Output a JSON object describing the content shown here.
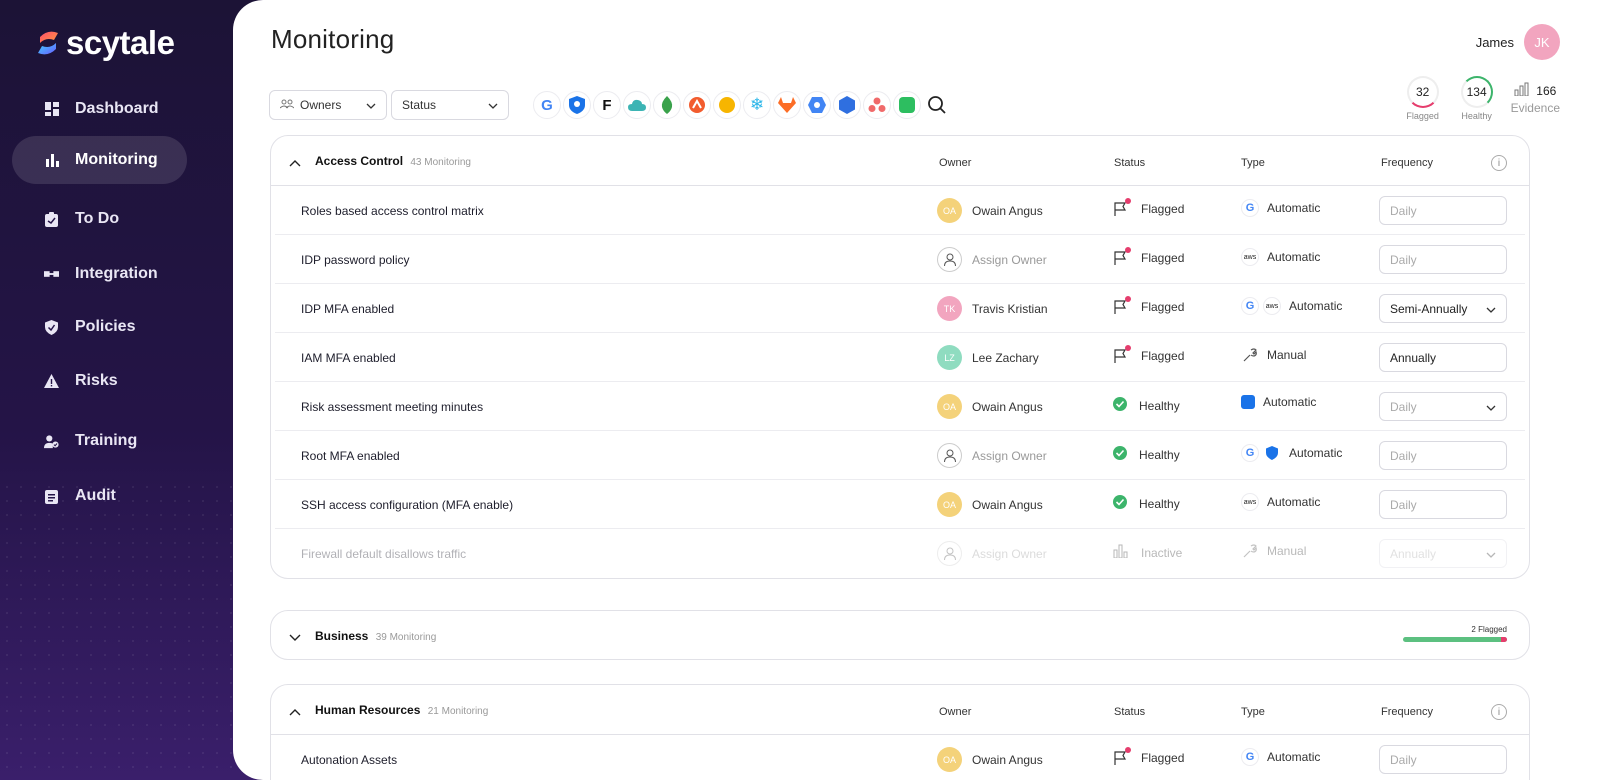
{
  "brand": {
    "name": "scytale"
  },
  "nav": [
    {
      "label": "Dashboard",
      "icon": "dashboard-icon"
    },
    {
      "label": "Monitoring",
      "icon": "bar-chart-icon",
      "active": true
    },
    {
      "label": "To Do",
      "icon": "clipboard-icon"
    },
    {
      "label": "Integration",
      "icon": "integration-icon"
    },
    {
      "label": "Policies",
      "icon": "shield-icon"
    },
    {
      "label": "Risks",
      "icon": "warning-icon"
    },
    {
      "label": "Training",
      "icon": "user-check-icon"
    },
    {
      "label": "Audit",
      "icon": "audit-icon"
    }
  ],
  "header": {
    "title": "Monitoring",
    "user_name": "James",
    "user_initials": "JK"
  },
  "filters": {
    "owners": "Owners",
    "status": "Status"
  },
  "integrations": [
    "google",
    "shield",
    "figma",
    "cloud",
    "mongodb",
    "atlassian",
    "miro",
    "snowflake",
    "gitlab",
    "gcp",
    "cube",
    "asana",
    "evernote"
  ],
  "stats": {
    "flagged_value": "32",
    "flagged_label": "Flagged",
    "healthy_value": "134",
    "healthy_label": "Healthy",
    "evidence_value": "166",
    "evidence_label": "Evidence"
  },
  "columns": {
    "owner": "Owner",
    "status": "Status",
    "type": "Type",
    "frequency": "Frequency"
  },
  "sections": [
    {
      "name": "Access Control",
      "count": "43 Monitoring",
      "rows": [
        {
          "name": "Roles based access control matrix",
          "owner": "Owain Angus",
          "initials": "OA",
          "avatar_color": "#f4d27a",
          "status": "Flagged",
          "type": "Automatic",
          "type_icons": [
            "G"
          ],
          "frequency": "Daily",
          "freq_placeholder": true,
          "dropdown": false
        },
        {
          "name": "IDP password policy",
          "owner": "Assign Owner",
          "initials": "",
          "avatar_color": "",
          "status": "Flagged",
          "type": "Automatic",
          "type_icons": [
            "aws"
          ],
          "frequency": "Daily",
          "freq_placeholder": true,
          "dropdown": false
        },
        {
          "name": "IDP MFA enabled",
          "owner": "Travis Kristian",
          "initials": "TK",
          "avatar_color": "#f2a5bf",
          "status": "Flagged",
          "type": "Automatic",
          "type_icons": [
            "G",
            "aws"
          ],
          "frequency": "Semi-Annually",
          "freq_placeholder": false,
          "dropdown": true
        },
        {
          "name": "IAM MFA enabled",
          "owner": "Lee Zachary",
          "initials": "LZ",
          "avatar_color": "#8fdcc0",
          "status": "Flagged",
          "type": "Manual",
          "type_icons": [
            "wrench"
          ],
          "frequency": "Annually",
          "freq_placeholder": false,
          "dropdown": false
        },
        {
          "name": "Risk assessment meeting minutes",
          "owner": "Owain Angus",
          "initials": "OA",
          "avatar_color": "#f4d27a",
          "status": "Healthy",
          "type": "Automatic",
          "type_icons": [
            "doc"
          ],
          "frequency": "Daily",
          "freq_placeholder": true,
          "dropdown": true
        },
        {
          "name": "Root MFA enabled",
          "owner": "Assign Owner",
          "initials": "",
          "avatar_color": "",
          "status": "Healthy",
          "type": "Automatic",
          "type_icons": [
            "G",
            "shield"
          ],
          "frequency": "Daily",
          "freq_placeholder": true,
          "dropdown": false
        },
        {
          "name": "SSH access configuration (MFA enable)",
          "owner": "Owain Angus",
          "initials": "OA",
          "avatar_color": "#f4d27a",
          "status": "Healthy",
          "type": "Automatic",
          "type_icons": [
            "aws"
          ],
          "frequency": "Daily",
          "freq_placeholder": true,
          "dropdown": false
        },
        {
          "name": "Firewall default disallows traffic",
          "owner": "Assign Owner",
          "initials": "",
          "avatar_color": "",
          "status": "Inactive",
          "type": "Manual",
          "type_icons": [
            "wrench"
          ],
          "frequency": "Annually",
          "freq_placeholder": true,
          "dropdown": true,
          "inactive": true
        }
      ]
    },
    {
      "name": "Business",
      "count": "39 Monitoring",
      "flagged_note": "2 Flagged",
      "healthy_fraction": 0.94
    },
    {
      "name": "Human Resources",
      "count": "21 Monitoring",
      "rows": [
        {
          "name": "Autonation Assets",
          "owner": "Owain Angus",
          "initials": "OA",
          "avatar_color": "#f4d27a",
          "status": "Flagged",
          "type": "Automatic",
          "type_icons": [
            "G"
          ],
          "frequency": "Daily",
          "freq_placeholder": true,
          "dropdown": false
        }
      ]
    }
  ],
  "colors": {
    "accent": "#3cb46b",
    "flag": "#e53d6d",
    "sidebar": "#241447"
  }
}
